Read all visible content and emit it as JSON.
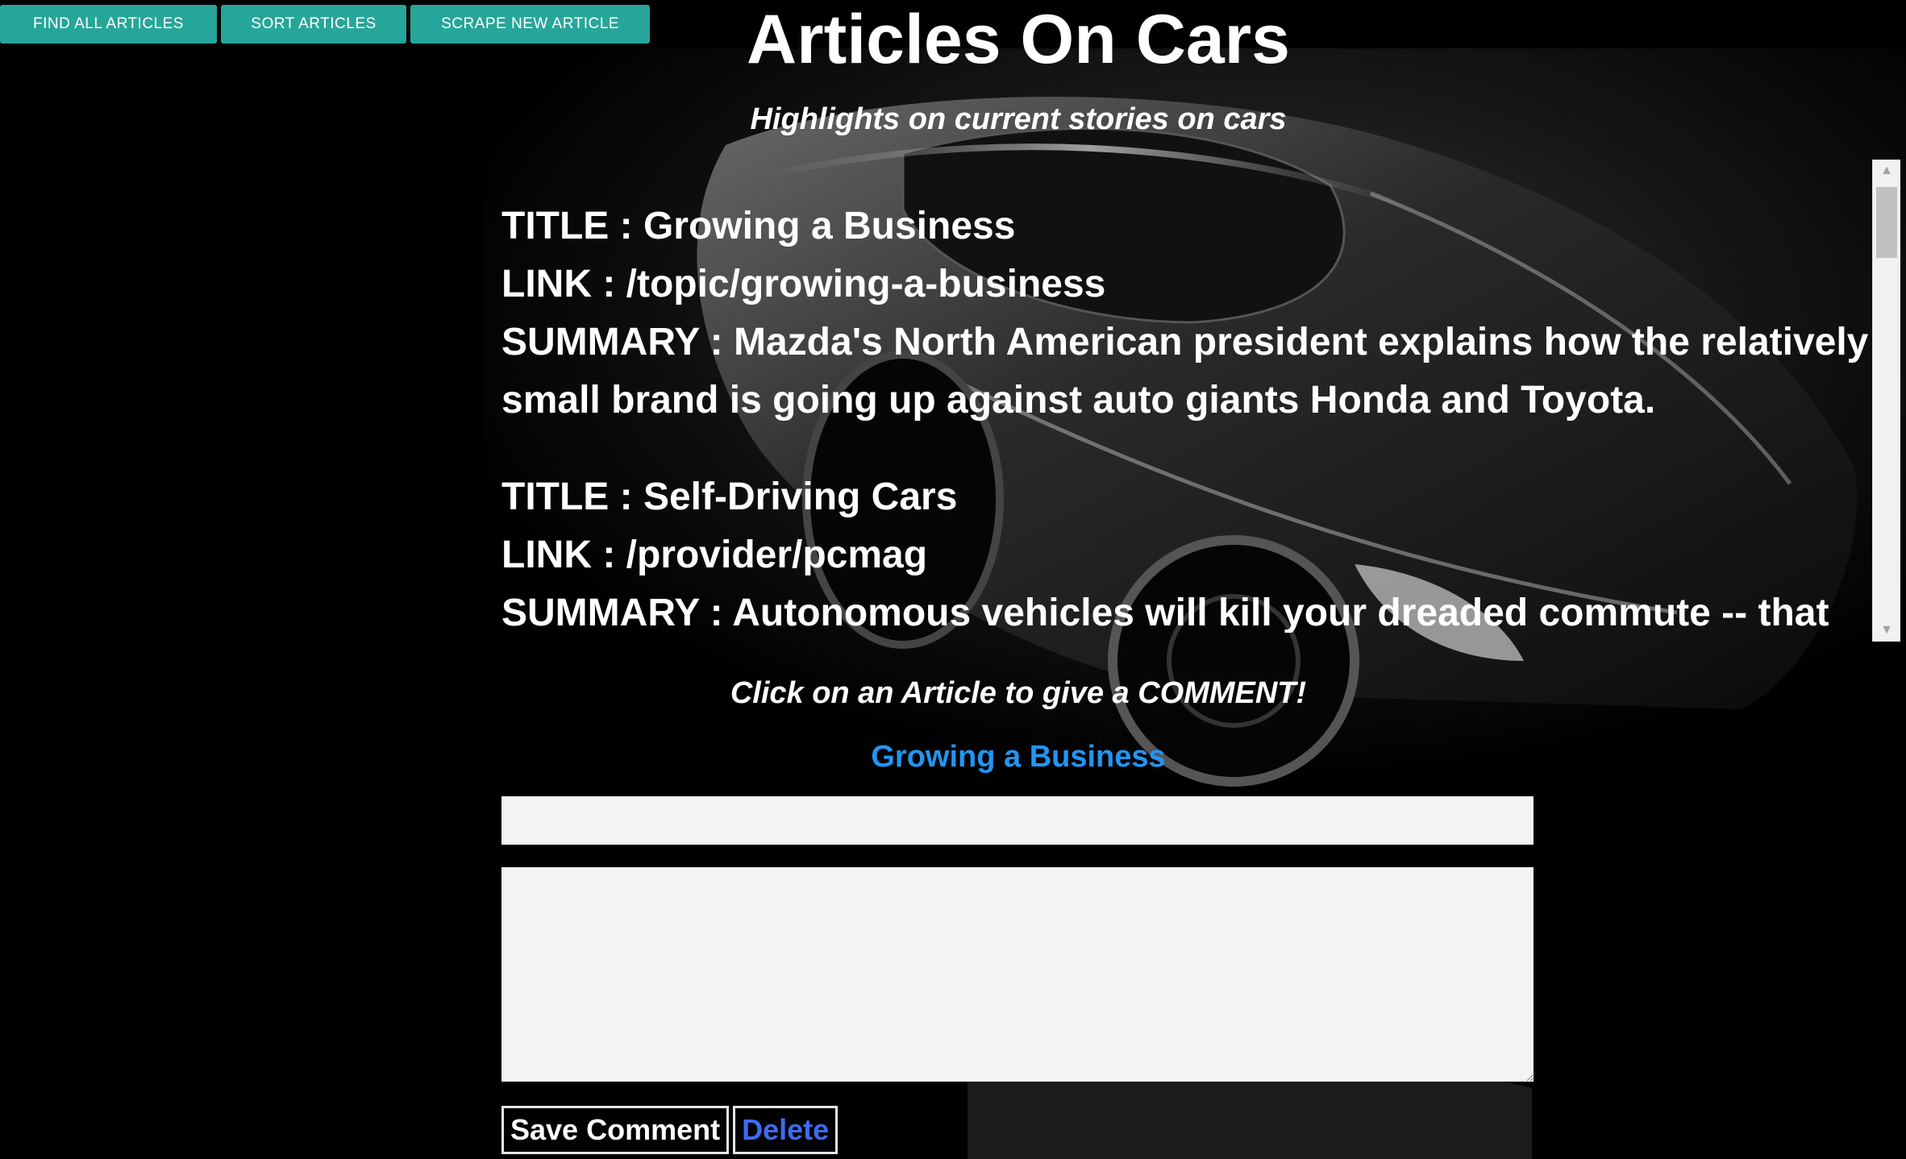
{
  "toolbar": {
    "find_all_label": "FIND ALL ARTICLES",
    "sort_label": "SORT ARTICLES",
    "scrape_label": "SCRAPE NEW ARTICLE"
  },
  "header": {
    "title": "Articles On Cars",
    "subtitle": "Highlights on current stories on cars"
  },
  "articles": [
    {
      "title_row": "TITLE : Growing a Business",
      "link_row": "LINK : /topic/growing-a-business",
      "summary_row": "SUMMARY : Mazda's North American president explains how the relatively small brand is going up against auto giants Honda and Toyota."
    },
    {
      "title_row": "TITLE : Self-Driving Cars",
      "link_row": "LINK : /provider/pcmag",
      "summary_row": "SUMMARY : Autonomous vehicles will kill your dreaded commute -- that is, if"
    }
  ],
  "comment": {
    "hint": "Click on an Article to give a COMMENT!",
    "selected_title": "Growing a Business",
    "title_value": "",
    "body_value": "",
    "save_label": "Save Comment",
    "delete_label": "Delete"
  },
  "colors": {
    "button_teal": "#26a69a",
    "selected_blue": "#2196f3",
    "delete_blue": "#3d6cf2",
    "background": "#000000"
  },
  "icons": {
    "scroll_up": "triangle-up-icon",
    "scroll_down": "triangle-down-icon",
    "background_image": "black-sports-car"
  }
}
